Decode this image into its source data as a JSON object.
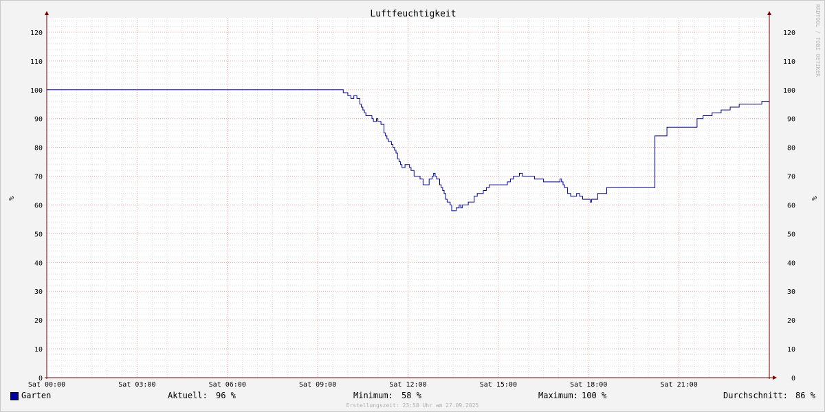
{
  "chart_data": {
    "type": "line",
    "title": "Luftfeuchtigkeit",
    "ylabel": "%",
    "ylim": [
      0,
      125
    ],
    "yticks": [
      0,
      10,
      20,
      30,
      40,
      50,
      60,
      70,
      80,
      90,
      100,
      110,
      120
    ],
    "xlim": [
      0,
      24
    ],
    "xticks": [
      {
        "h": 0,
        "label": "Sat 00:00"
      },
      {
        "h": 3,
        "label": "Sat 03:00"
      },
      {
        "h": 6,
        "label": "Sat 06:00"
      },
      {
        "h": 9,
        "label": "Sat 09:00"
      },
      {
        "h": 12,
        "label": "Sat 12:00"
      },
      {
        "h": 15,
        "label": "Sat 15:00"
      },
      {
        "h": 18,
        "label": "Sat 18:00"
      },
      {
        "h": 21,
        "label": "Sat 21:00"
      }
    ],
    "grid": true,
    "watermark": "RRDTOOL / TOBI OETIKER",
    "series": [
      {
        "name": "Garten",
        "color": "#0000a0",
        "x": [
          0,
          9.8,
          9.85,
          9.95,
          10.0,
          10.1,
          10.2,
          10.3,
          10.4,
          10.45,
          10.5,
          10.55,
          10.6,
          10.7,
          10.8,
          10.85,
          10.9,
          10.95,
          11.0,
          11.1,
          11.2,
          11.25,
          11.3,
          11.35,
          11.4,
          11.45,
          11.5,
          11.55,
          11.6,
          11.65,
          11.7,
          11.75,
          11.8,
          11.9,
          12.0,
          12.05,
          12.1,
          12.2,
          12.3,
          12.4,
          12.5,
          12.55,
          12.6,
          12.7,
          12.8,
          12.85,
          12.9,
          12.95,
          13.0,
          13.05,
          13.1,
          13.15,
          13.2,
          13.25,
          13.3,
          13.35,
          13.4,
          13.45,
          13.5,
          13.55,
          13.6,
          13.65,
          13.7,
          13.75,
          13.8,
          13.9,
          14.0,
          14.1,
          14.2,
          14.3,
          14.4,
          14.5,
          14.6,
          14.7,
          14.8,
          15.0,
          15.2,
          15.3,
          15.4,
          15.5,
          15.6,
          15.7,
          15.8,
          16.0,
          16.1,
          16.2,
          16.3,
          16.5,
          16.8,
          17.0,
          17.05,
          17.1,
          17.15,
          17.2,
          17.3,
          17.4,
          17.5,
          17.6,
          17.7,
          17.8,
          17.9,
          18.0,
          18.05,
          18.1,
          18.2,
          18.3,
          18.6,
          19.9,
          20.2,
          20.25,
          20.6,
          21.1,
          21.35,
          21.6,
          21.8,
          22.1,
          22.4,
          22.7,
          23.0,
          23.5,
          23.75,
          24
        ],
        "values": [
          100,
          100,
          99,
          99,
          98,
          97,
          98,
          97,
          95,
          94,
          93,
          92,
          91,
          91,
          90,
          89,
          89,
          90,
          89,
          88,
          85,
          84,
          83,
          82,
          82,
          81,
          80,
          79,
          78,
          76,
          75,
          74,
          73,
          74,
          74,
          73,
          72,
          70,
          70,
          69,
          67,
          67,
          67,
          69,
          70,
          71,
          70,
          69,
          69,
          67,
          66,
          65,
          64,
          62,
          61,
          61,
          60,
          58,
          58,
          58,
          59,
          59,
          60,
          59,
          60,
          60,
          61,
          61,
          63,
          64,
          64,
          65,
          66,
          67,
          67,
          67,
          67,
          68,
          69,
          70,
          70,
          71,
          70,
          70,
          70,
          69,
          69,
          68,
          68,
          68,
          69,
          68,
          67,
          66,
          64,
          63,
          63,
          64,
          63,
          62,
          62,
          62,
          61,
          62,
          62,
          64,
          66,
          66,
          84,
          84,
          87,
          87,
          87,
          90,
          91,
          92,
          93,
          94,
          95,
          95,
          96,
          96
        ]
      }
    ]
  },
  "legend": {
    "series_name": "Garten",
    "current_label": "Aktuell:",
    "current_value": "96 %",
    "min_label": "Minimum:",
    "min_value": "58 %",
    "max_label": "Maximum:",
    "max_value": "100 %",
    "avg_label": "Durchschnitt:",
    "avg_value": "86 %"
  },
  "footer": "Erstellungszeit: 23:58 Uhr am 27.09.2025"
}
